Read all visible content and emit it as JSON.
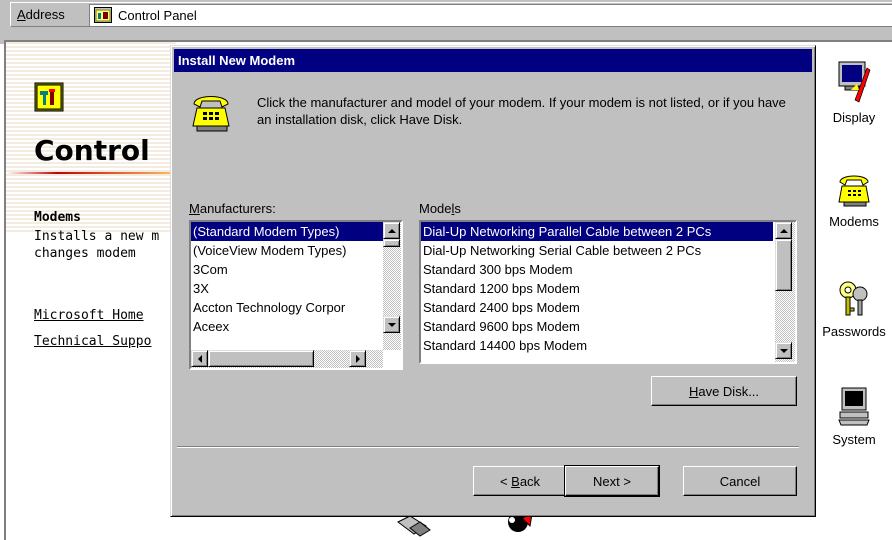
{
  "address_bar": {
    "label": "Address",
    "value": "Control Panel",
    "icon": "control-panel-icon"
  },
  "web_view": {
    "title": "Control",
    "selected_item": {
      "title": "Modems",
      "description_line1": "Installs a new m",
      "description_line2": "changes modem"
    },
    "links": [
      "Microsoft Home",
      "Technical Suppo"
    ]
  },
  "icons": [
    {
      "label": "Display",
      "icon": "display-icon"
    },
    {
      "label": "Modems",
      "icon": "modem-telephone-icon"
    },
    {
      "label": "Passwords",
      "icon": "keys-icon"
    },
    {
      "label": "System",
      "icon": "computer-icon"
    }
  ],
  "dialog": {
    "title": "Install New Modem",
    "message": "Click the manufacturer and model of your modem. If your modem is not listed, or if you have an installation disk, click Have Disk.",
    "manufacturers_label": "Manufacturers:",
    "models_label": "Models",
    "manufacturers": [
      "(Standard Modem Types)",
      "(VoiceView Modem Types)",
      "3Com",
      "3X",
      "Accton Technology Corpor",
      "Aceex"
    ],
    "models": [
      "Dial-Up Networking Parallel Cable between 2 PCs",
      "Dial-Up Networking Serial Cable between 2 PCs",
      "Standard   300 bps Modem",
      "Standard  1200 bps Modem",
      "Standard  2400 bps Modem",
      "Standard  9600 bps Modem",
      "Standard 14400 bps Modem"
    ],
    "have_disk_label": "Have Disk...",
    "back_label": "< Back",
    "next_label": "Next >",
    "cancel_label": "Cancel"
  },
  "colors": {
    "face": "#c0c0c0",
    "title_bar": "#000080",
    "selection": "#000080"
  }
}
